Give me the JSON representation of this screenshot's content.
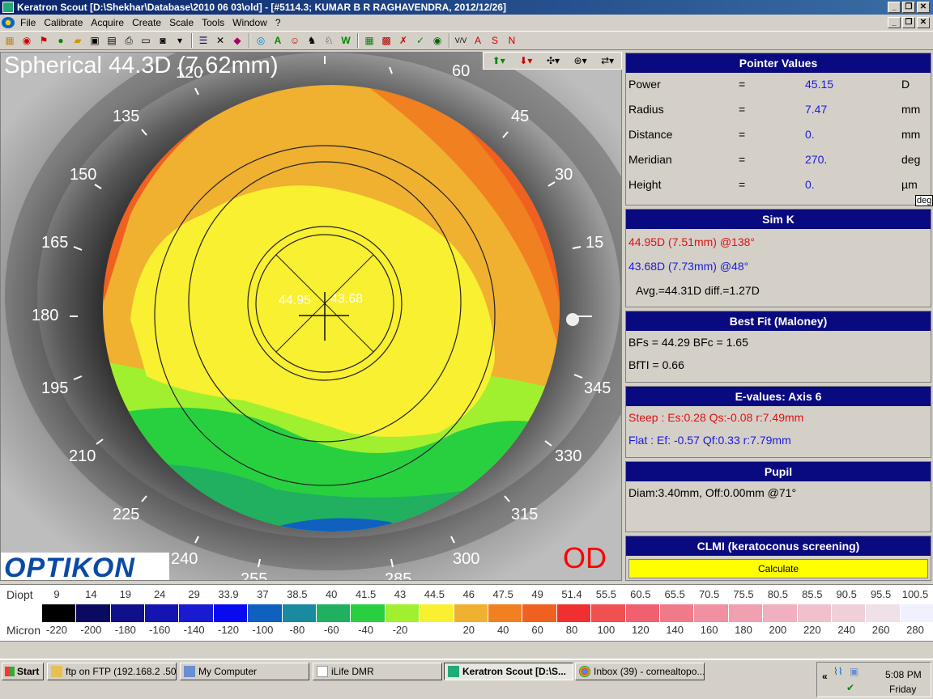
{
  "window": {
    "title": "Keratron Scout [D:\\Shekhar\\Database\\2010 06 03\\old] - [#5114.3; KUMAR B R RAGHAVENDRA, 2012/12/26]"
  },
  "menu": [
    "File",
    "Calibrate",
    "Acquire",
    "Create",
    "Scale",
    "Tools",
    "Window",
    "?"
  ],
  "map": {
    "title": "Spherical  44.3D (7.62mm)",
    "eye": "OD",
    "logo": "OPTIKON",
    "center_values": [
      "44.95",
      "43.68"
    ],
    "angles": [
      "60",
      "45",
      "30",
      "15",
      "345",
      "330",
      "315",
      "300",
      "285",
      "255",
      "240",
      "225",
      "210",
      "195",
      "180",
      "165",
      "150",
      "135",
      "120"
    ]
  },
  "pointer_values": {
    "header": "Pointer Values",
    "rows": [
      {
        "label": "Power",
        "eq": "=",
        "value": "45.15",
        "unit": "D"
      },
      {
        "label": "Radius",
        "eq": "=",
        "value": "7.47",
        "unit": "mm"
      },
      {
        "label": "Distance",
        "eq": "=",
        "value": "0.",
        "unit": "mm"
      },
      {
        "label": "Meridian",
        "eq": "=",
        "value": "270.",
        "unit": "deg"
      },
      {
        "label": "Height",
        "eq": "=",
        "value": "0.",
        "unit": "µm"
      }
    ],
    "deg_tag": "deg"
  },
  "simk": {
    "header": "Sim K",
    "steep": "44.95D (7.51mm) @138°",
    "flat": "43.68D (7.73mm) @48°",
    "avg": "Avg.=44.31D  diff.=1.27D"
  },
  "bestfit": {
    "header": "Best Fit (Maloney)",
    "line1": "BFs = 44.29 BFc = 1.65",
    "line2": "BfTI = 0.66"
  },
  "evalues": {
    "header": "E-values: Axis 6",
    "steep": "Steep :  Es:0.28 Qs:-0.08 r:7.49mm",
    "flat": "Flat    :  Ef: -0.57 Qf:0.33 r:7.79mm"
  },
  "pupil": {
    "header": "Pupil",
    "line": "Diam:3.40mm, Off:0.00mm @71°"
  },
  "clmi": {
    "header": "CLMI (keratoconus screening)",
    "button": "Calculate"
  },
  "scale": {
    "diopt_label": "Diopt",
    "micron_label": "Micron",
    "diopt": [
      "9",
      "14",
      "19",
      "24",
      "29",
      "33.9",
      "37",
      "38.5",
      "40",
      "41.5",
      "43",
      "44.5",
      "46",
      "47.5",
      "49",
      "51.4",
      "55.5",
      "60.5",
      "65.5",
      "70.5",
      "75.5",
      "80.5",
      "85.5",
      "90.5",
      "95.5",
      "100.5"
    ],
    "micron": [
      "-220",
      "-200",
      "-180",
      "-160",
      "-140",
      "-120",
      "-100",
      "-80",
      "-60",
      "-40",
      "-20",
      "",
      "20",
      "40",
      "60",
      "80",
      "100",
      "120",
      "140",
      "160",
      "180",
      "200",
      "220",
      "240",
      "260",
      "280"
    ],
    "colors": [
      "#000000",
      "#0a0a60",
      "#10108a",
      "#1414b0",
      "#1a1ad0",
      "#0a0af0",
      "#1060c0",
      "#1a8aa0",
      "#20b060",
      "#28d040",
      "#a0f030",
      "#f8f030",
      "#f0b030",
      "#f08020",
      "#f06020",
      "#f03030",
      "#f05050",
      "#f06070",
      "#f07a88",
      "#f090a0",
      "#f0a0b0",
      "#f0b0c0",
      "#f0c0cc",
      "#f0d0d8",
      "#f0e0e8",
      "#f0f0ff"
    ]
  },
  "taskbar": {
    "start": "Start",
    "tasks": [
      "ftp on FTP (192.168.2 .50)",
      "My Computer",
      "iLife DMR",
      "Keratron Scout [D:\\S...",
      "Inbox (39) - cornealtopo..."
    ],
    "time": "5:08 PM",
    "day": "Friday"
  }
}
